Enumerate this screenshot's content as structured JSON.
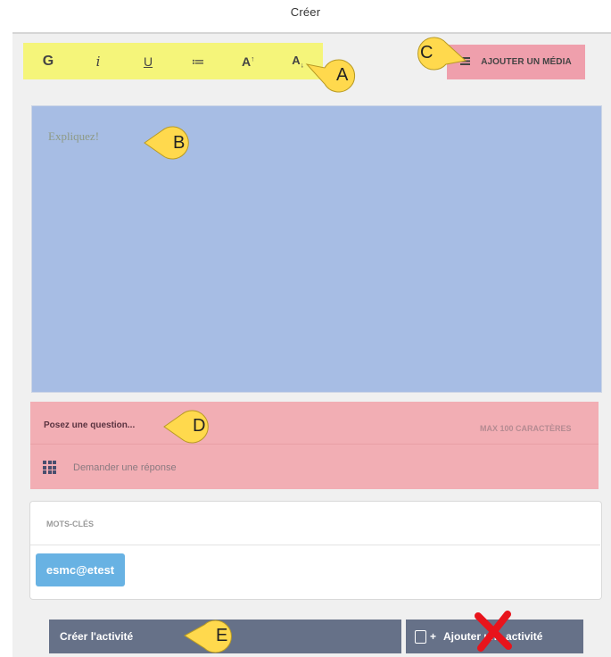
{
  "page": {
    "title": "Créer"
  },
  "toolbar": {
    "bold": "G",
    "italic": "i",
    "underline": "U",
    "list": "≔",
    "increase": "A",
    "increase_sup": "↑",
    "decrease": "A",
    "decrease_sub": "↓"
  },
  "media": {
    "label": "AJOUTER UN MÉDIA",
    "icon": "list-icon"
  },
  "editor": {
    "placeholder": "Expliquez!"
  },
  "question": {
    "label": "Posez une question...",
    "max": "MAX 100 CARACTÈRES",
    "answer_label": "Demander une réponse",
    "answer_icon": "grid-icon"
  },
  "keywords": {
    "label": "MOTS-CLÉS",
    "tags": [
      "esmc@etest"
    ]
  },
  "footer": {
    "create_label": "Créer l'activité",
    "add_label": "Ajouter une activité",
    "add_icon": "add-page-icon"
  },
  "callouts": {
    "a": "A",
    "b": "B",
    "c": "C",
    "d": "D",
    "e": "E"
  },
  "colors": {
    "toolbar_highlight": "#f5f57a",
    "media_highlight": "#ef9fac",
    "editor_highlight": "#a7bde4",
    "question_highlight": "#f2aeb4",
    "tag": "#68b2e3",
    "button": "#667188",
    "callout": "#ffd94d",
    "cross": "#e8141c"
  }
}
